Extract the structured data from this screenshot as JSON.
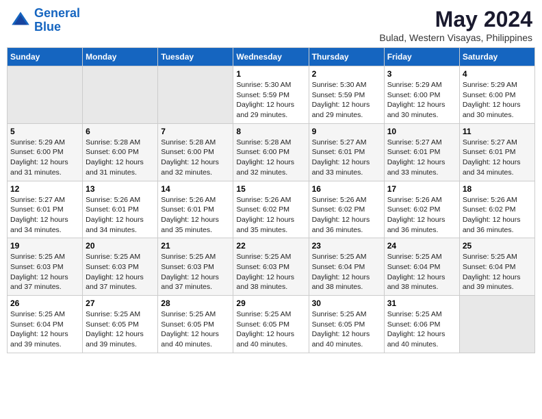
{
  "logo": {
    "line1": "General",
    "line2": "Blue"
  },
  "title": "May 2024",
  "subtitle": "Bulad, Western Visayas, Philippines",
  "headers": [
    "Sunday",
    "Monday",
    "Tuesday",
    "Wednesday",
    "Thursday",
    "Friday",
    "Saturday"
  ],
  "weeks": [
    [
      {
        "day": "",
        "info": ""
      },
      {
        "day": "",
        "info": ""
      },
      {
        "day": "",
        "info": ""
      },
      {
        "day": "1",
        "info": "Sunrise: 5:30 AM\nSunset: 5:59 PM\nDaylight: 12 hours\nand 29 minutes."
      },
      {
        "day": "2",
        "info": "Sunrise: 5:30 AM\nSunset: 5:59 PM\nDaylight: 12 hours\nand 29 minutes."
      },
      {
        "day": "3",
        "info": "Sunrise: 5:29 AM\nSunset: 6:00 PM\nDaylight: 12 hours\nand 30 minutes."
      },
      {
        "day": "4",
        "info": "Sunrise: 5:29 AM\nSunset: 6:00 PM\nDaylight: 12 hours\nand 30 minutes."
      }
    ],
    [
      {
        "day": "5",
        "info": "Sunrise: 5:29 AM\nSunset: 6:00 PM\nDaylight: 12 hours\nand 31 minutes."
      },
      {
        "day": "6",
        "info": "Sunrise: 5:28 AM\nSunset: 6:00 PM\nDaylight: 12 hours\nand 31 minutes."
      },
      {
        "day": "7",
        "info": "Sunrise: 5:28 AM\nSunset: 6:00 PM\nDaylight: 12 hours\nand 32 minutes."
      },
      {
        "day": "8",
        "info": "Sunrise: 5:28 AM\nSunset: 6:00 PM\nDaylight: 12 hours\nand 32 minutes."
      },
      {
        "day": "9",
        "info": "Sunrise: 5:27 AM\nSunset: 6:01 PM\nDaylight: 12 hours\nand 33 minutes."
      },
      {
        "day": "10",
        "info": "Sunrise: 5:27 AM\nSunset: 6:01 PM\nDaylight: 12 hours\nand 33 minutes."
      },
      {
        "day": "11",
        "info": "Sunrise: 5:27 AM\nSunset: 6:01 PM\nDaylight: 12 hours\nand 34 minutes."
      }
    ],
    [
      {
        "day": "12",
        "info": "Sunrise: 5:27 AM\nSunset: 6:01 PM\nDaylight: 12 hours\nand 34 minutes."
      },
      {
        "day": "13",
        "info": "Sunrise: 5:26 AM\nSunset: 6:01 PM\nDaylight: 12 hours\nand 34 minutes."
      },
      {
        "day": "14",
        "info": "Sunrise: 5:26 AM\nSunset: 6:01 PM\nDaylight: 12 hours\nand 35 minutes."
      },
      {
        "day": "15",
        "info": "Sunrise: 5:26 AM\nSunset: 6:02 PM\nDaylight: 12 hours\nand 35 minutes."
      },
      {
        "day": "16",
        "info": "Sunrise: 5:26 AM\nSunset: 6:02 PM\nDaylight: 12 hours\nand 36 minutes."
      },
      {
        "day": "17",
        "info": "Sunrise: 5:26 AM\nSunset: 6:02 PM\nDaylight: 12 hours\nand 36 minutes."
      },
      {
        "day": "18",
        "info": "Sunrise: 5:26 AM\nSunset: 6:02 PM\nDaylight: 12 hours\nand 36 minutes."
      }
    ],
    [
      {
        "day": "19",
        "info": "Sunrise: 5:25 AM\nSunset: 6:03 PM\nDaylight: 12 hours\nand 37 minutes."
      },
      {
        "day": "20",
        "info": "Sunrise: 5:25 AM\nSunset: 6:03 PM\nDaylight: 12 hours\nand 37 minutes."
      },
      {
        "day": "21",
        "info": "Sunrise: 5:25 AM\nSunset: 6:03 PM\nDaylight: 12 hours\nand 37 minutes."
      },
      {
        "day": "22",
        "info": "Sunrise: 5:25 AM\nSunset: 6:03 PM\nDaylight: 12 hours\nand 38 minutes."
      },
      {
        "day": "23",
        "info": "Sunrise: 5:25 AM\nSunset: 6:04 PM\nDaylight: 12 hours\nand 38 minutes."
      },
      {
        "day": "24",
        "info": "Sunrise: 5:25 AM\nSunset: 6:04 PM\nDaylight: 12 hours\nand 38 minutes."
      },
      {
        "day": "25",
        "info": "Sunrise: 5:25 AM\nSunset: 6:04 PM\nDaylight: 12 hours\nand 39 minutes."
      }
    ],
    [
      {
        "day": "26",
        "info": "Sunrise: 5:25 AM\nSunset: 6:04 PM\nDaylight: 12 hours\nand 39 minutes."
      },
      {
        "day": "27",
        "info": "Sunrise: 5:25 AM\nSunset: 6:05 PM\nDaylight: 12 hours\nand 39 minutes."
      },
      {
        "day": "28",
        "info": "Sunrise: 5:25 AM\nSunset: 6:05 PM\nDaylight: 12 hours\nand 40 minutes."
      },
      {
        "day": "29",
        "info": "Sunrise: 5:25 AM\nSunset: 6:05 PM\nDaylight: 12 hours\nand 40 minutes."
      },
      {
        "day": "30",
        "info": "Sunrise: 5:25 AM\nSunset: 6:05 PM\nDaylight: 12 hours\nand 40 minutes."
      },
      {
        "day": "31",
        "info": "Sunrise: 5:25 AM\nSunset: 6:06 PM\nDaylight: 12 hours\nand 40 minutes."
      },
      {
        "day": "",
        "info": ""
      }
    ]
  ]
}
